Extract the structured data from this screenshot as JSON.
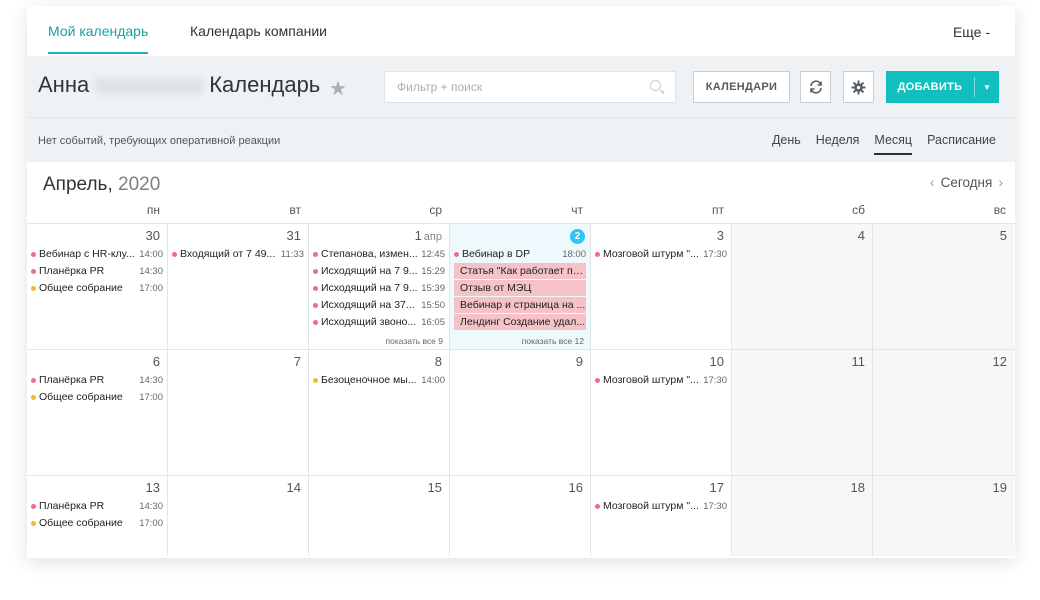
{
  "tabs": {
    "my": "Мой календарь",
    "company": "Календарь компании",
    "more": "Еще -"
  },
  "header": {
    "name": "Анна",
    "title": "Календарь",
    "search_placeholder": "Фильтр + поиск",
    "calendars_btn": "КАЛЕНДАРИ",
    "add_btn": "ДОБАВИТЬ"
  },
  "subbar": {
    "notice": "Нет событий, требующих оперативной реакции",
    "views": [
      "День",
      "Неделя",
      "Месяц",
      "Расписание"
    ],
    "active_view": "Месяц"
  },
  "calendar": {
    "month": "Апрель,",
    "year": "2020",
    "today_label": "Сегодня",
    "weekdays": [
      "пн",
      "вт",
      "ср",
      "чт",
      "пт",
      "сб",
      "вс"
    ],
    "weeks": [
      [
        {
          "num": "30",
          "events": [
            {
              "title": "Вебинар с HR-клу...",
              "time": "14:00",
              "color": "#ef6b8a"
            },
            {
              "title": "Планёрка PR",
              "time": "14:30",
              "color": "#ef6b8a"
            },
            {
              "title": "Общее собрание",
              "time": "17:00",
              "color": "#f5b82e"
            }
          ]
        },
        {
          "num": "31",
          "events": [
            {
              "title": "Входящий от 7 49...",
              "time": "11:33",
              "color": "#ef6b8a"
            }
          ]
        },
        {
          "num": "1",
          "mon": "апр",
          "events": [
            {
              "title": "Степанова, измен...",
              "time": "12:45",
              "color": "#ef6b8a"
            },
            {
              "title": "Исходящий на 7 9...",
              "time": "15:29",
              "color": "#ef6b8a"
            },
            {
              "title": "Исходящий на 7 9...",
              "time": "15:39",
              "color": "#ef6b8a"
            },
            {
              "title": "Исходящий на 37...",
              "time": "15:50",
              "color": "#ef6b8a"
            },
            {
              "title": "Исходящий звоно...",
              "time": "16:05",
              "color": "#ef6b8a"
            }
          ],
          "showall": "показать все 9"
        },
        {
          "num": "2",
          "today": true,
          "events": [
            {
              "title": "Вебинар в DP",
              "time": "18:00",
              "color": "#ef6b8a"
            },
            {
              "title": "Статья \"Как работает пе...",
              "block": true
            },
            {
              "title": "Отзыв от МЭЦ",
              "block": true
            },
            {
              "title": "Вебинар и страница на ...",
              "block": true
            },
            {
              "title": "Лендинг Создание удал...",
              "block": true
            }
          ],
          "showall": "показать все 12"
        },
        {
          "num": "3",
          "events": [
            {
              "title": "Мозговой штурм \"...",
              "time": "17:30",
              "color": "#ef6b8a"
            }
          ]
        },
        {
          "num": "4",
          "weekend": true,
          "events": []
        },
        {
          "num": "5",
          "weekend": true,
          "events": []
        }
      ],
      [
        {
          "num": "6",
          "events": [
            {
              "title": "Планёрка PR",
              "time": "14:30",
              "color": "#ef6b8a"
            },
            {
              "title": "Общее собрание",
              "time": "17:00",
              "color": "#f5b82e"
            }
          ]
        },
        {
          "num": "7",
          "events": []
        },
        {
          "num": "8",
          "events": [
            {
              "title": "Безоценочное мы...",
              "time": "14:00",
              "color": "#f5b82e"
            }
          ]
        },
        {
          "num": "9",
          "events": []
        },
        {
          "num": "10",
          "events": [
            {
              "title": "Мозговой штурм \"...",
              "time": "17:30",
              "color": "#ef6b8a"
            }
          ]
        },
        {
          "num": "11",
          "weekend": true,
          "events": []
        },
        {
          "num": "12",
          "weekend": true,
          "events": []
        }
      ],
      [
        {
          "num": "13",
          "events": [
            {
              "title": "Планёрка PR",
              "time": "14:30",
              "color": "#ef6b8a"
            },
            {
              "title": "Общее собрание",
              "time": "17:00",
              "color": "#f5b82e"
            }
          ]
        },
        {
          "num": "14",
          "events": []
        },
        {
          "num": "15",
          "events": []
        },
        {
          "num": "16",
          "events": []
        },
        {
          "num": "17",
          "events": [
            {
              "title": "Мозговой штурм \"...",
              "time": "17:30",
              "color": "#ef6b8a"
            }
          ]
        },
        {
          "num": "18",
          "weekend": true,
          "events": []
        },
        {
          "num": "19",
          "weekend": true,
          "events": []
        }
      ]
    ]
  },
  "colors": {
    "accent": "#12bfbf",
    "event_pink": "#ef6b8a",
    "event_yellow": "#f5b82e",
    "today_badge": "#2fc6f6"
  }
}
